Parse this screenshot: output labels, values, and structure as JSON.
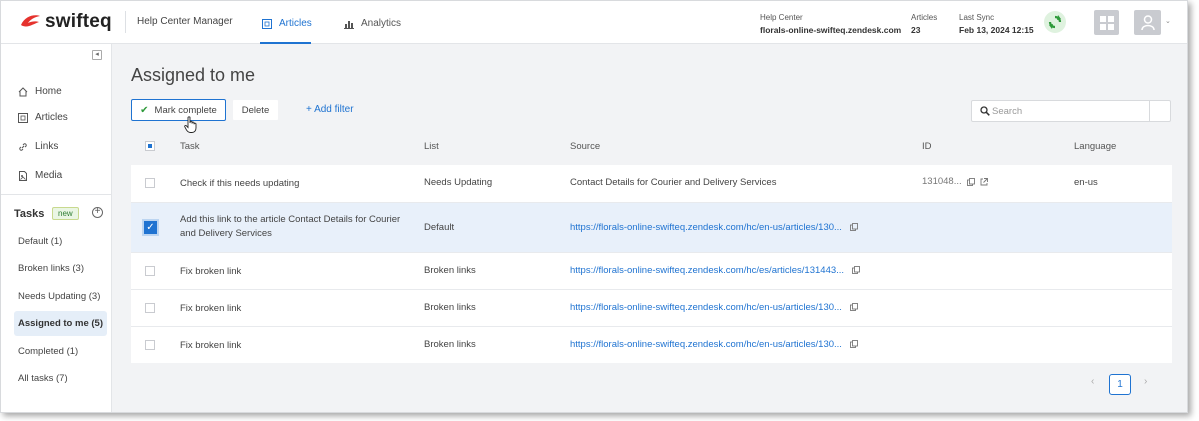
{
  "header": {
    "logo_text": "swifteq",
    "app_title": "Help Center Manager",
    "tabs": [
      {
        "label": "Articles",
        "icon": "articles-icon",
        "active": true
      },
      {
        "label": "Analytics",
        "icon": "analytics-icon",
        "active": false
      }
    ],
    "help_center": {
      "label": "Help Center",
      "value": "florals-online-swifteq.zendesk.com"
    },
    "articles": {
      "label": "Articles",
      "value": "23"
    },
    "last_sync": {
      "label": "Last Sync",
      "value": "Feb 13, 2024 12:15"
    },
    "accent_color": "#1f73d1"
  },
  "sidebar": {
    "collapse_icon": "collapse-sidebar-icon",
    "items": [
      {
        "label": "Home",
        "icon": "home-icon"
      },
      {
        "label": "Articles",
        "icon": "articles-icon"
      },
      {
        "label": "Links",
        "icon": "link-icon"
      },
      {
        "label": "Media",
        "icon": "media-icon"
      }
    ],
    "tasks_heading": "Tasks",
    "new_badge": "new",
    "task_lists": [
      {
        "label": "Default (1)",
        "active": false
      },
      {
        "label": "Broken links (3)",
        "active": false
      },
      {
        "label": "Needs Updating (3)",
        "active": false
      },
      {
        "label": "Assigned to me (5)",
        "active": true
      },
      {
        "label": "Completed (1)",
        "active": false
      },
      {
        "label": "All tasks (7)",
        "active": false
      }
    ]
  },
  "main": {
    "title": "Assigned to me",
    "toolbar": {
      "mark_complete": "Mark complete",
      "delete": "Delete",
      "add_filter": "+ Add filter"
    },
    "search": {
      "placeholder": "Search",
      "value": ""
    },
    "columns": {
      "task": "Task",
      "list": "List",
      "source": "Source",
      "id": "ID",
      "language": "Language"
    },
    "rows": [
      {
        "task": "Check if this needs updating",
        "list": "Needs Updating",
        "source": "Contact Details for Courier and Delivery Services",
        "source_is_link": false,
        "id": "131048...",
        "language": "en-us",
        "checked": false
      },
      {
        "task": "Add this link to the article Contact Details for Courier and Delivery Services",
        "list": "Default",
        "source": "https://florals-online-swifteq.zendesk.com/hc/en-us/articles/130...",
        "source_is_link": true,
        "id": "",
        "language": "",
        "checked": true
      },
      {
        "task": "Fix broken link",
        "list": "Broken links",
        "source": "https://florals-online-swifteq.zendesk.com/hc/es/articles/131443...",
        "source_is_link": true,
        "id": "",
        "language": "",
        "checked": false
      },
      {
        "task": "Fix broken link",
        "list": "Broken links",
        "source": "https://florals-online-swifteq.zendesk.com/hc/en-us/articles/130...",
        "source_is_link": true,
        "id": "",
        "language": "",
        "checked": false
      },
      {
        "task": "Fix broken link",
        "list": "Broken links",
        "source": "https://florals-online-swifteq.zendesk.com/hc/en-us/articles/130...",
        "source_is_link": true,
        "id": "",
        "language": "",
        "checked": false
      }
    ],
    "pagination": {
      "prev": "‹",
      "current": "1",
      "next": "›"
    }
  }
}
